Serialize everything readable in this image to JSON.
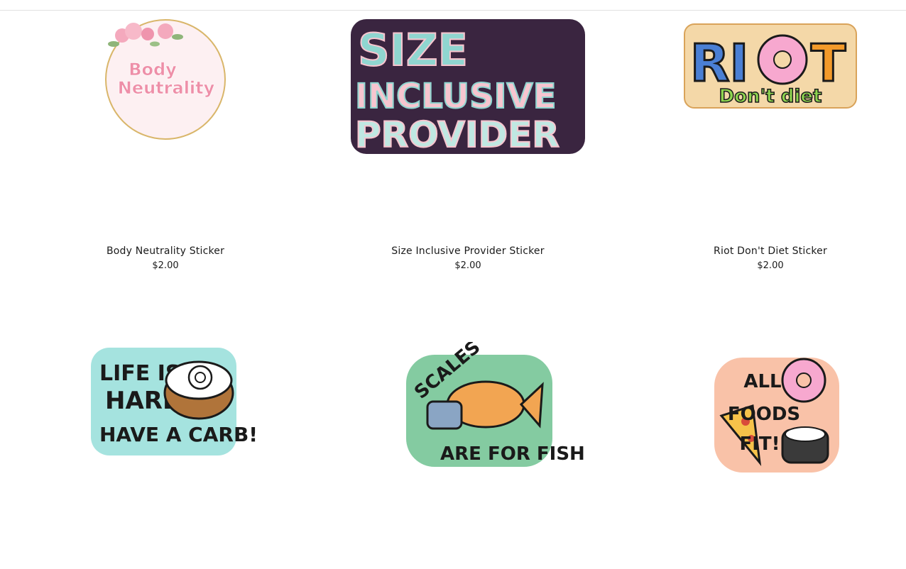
{
  "products": [
    {
      "title": "Body Neutrality Sticker",
      "price": "$2.00",
      "art": [
        "Body",
        "Neutrality"
      ]
    },
    {
      "title": "Size Inclusive Provider Sticker",
      "price": "$2.00",
      "art": [
        "SIZE",
        "INCLUSIVE",
        "PROVIDER"
      ]
    },
    {
      "title": "Riot Don't Diet Sticker",
      "price": "$2.00",
      "art": [
        "RI",
        "T",
        "Don't diet"
      ]
    },
    {
      "title": "",
      "price": "",
      "art": [
        "LIFE IS",
        "HARD,",
        "HAVE A CARB!"
      ]
    },
    {
      "title": "",
      "price": "",
      "art": [
        "SCALES",
        "ARE FOR FISH"
      ]
    },
    {
      "title": "",
      "price": "",
      "art": [
        "ALL",
        "FOODS",
        "FIT!"
      ]
    }
  ],
  "colors": {
    "pink": "#f3a6b8",
    "purple_outline": "#3a2540",
    "teal": "#8fd6d0",
    "mint": "#a8dcc0",
    "peach": "#f9c2a8"
  }
}
